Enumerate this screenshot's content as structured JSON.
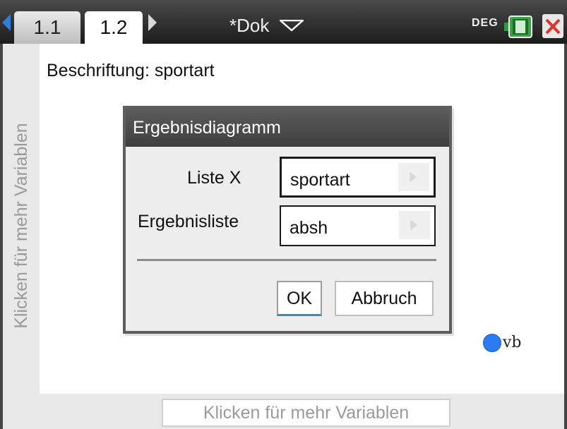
{
  "header": {
    "tabs": [
      {
        "label": "1.1",
        "active": false
      },
      {
        "label": "1.2",
        "active": true
      }
    ],
    "document_title": "*Dok",
    "angle_mode": "DEG"
  },
  "workspace": {
    "label_text": "Beschriftung: sportart",
    "y_variable_prompt": "Klicken für mehr Variablen",
    "x_variable_prompt": "Klicken für mehr Variablen",
    "legend": {
      "label": "vb",
      "color": "#2a7cf0"
    }
  },
  "dialog": {
    "title": "Ergebnisdiagramm",
    "fields": [
      {
        "label": "Liste X",
        "value": "sportart"
      },
      {
        "label": "Ergebnisliste",
        "value": "absh"
      }
    ],
    "ok_label": "OK",
    "cancel_label": "Abbruch"
  },
  "icons": [
    "nav-left-icon",
    "nav-right-icon",
    "document-menu-icon",
    "battery-icon",
    "close-icon",
    "chevron-right-icon"
  ],
  "colors": {
    "accent": "#2f7fd8",
    "close": "#e0332b",
    "titlebar": "#3e3e3e"
  }
}
